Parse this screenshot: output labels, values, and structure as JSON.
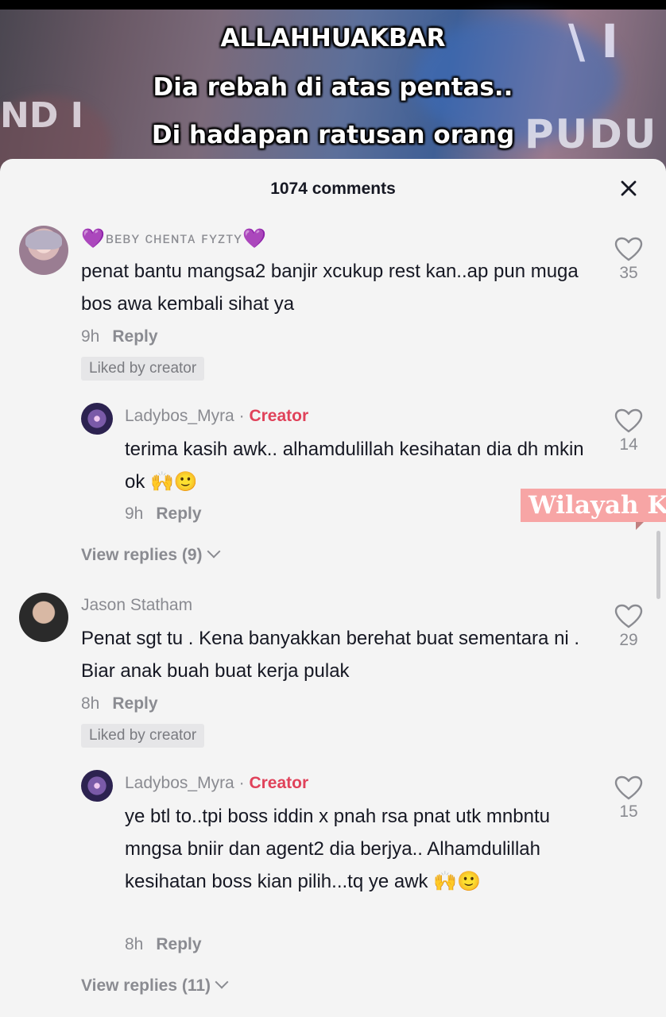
{
  "video": {
    "caption_lines": [
      "ALLAHHUAKBAR",
      "Dia rebah di atas pentas..",
      "Di hadapan ratusan orang"
    ],
    "bg_sign_left": "ND I",
    "bg_sign_right": "PUDU |",
    "bg_sign_top": "\\ I"
  },
  "sheet": {
    "title": "1074 comments"
  },
  "comments": [
    {
      "username": "ʙᴇʙʏ ᴄʜᴇɴᴛᴀ ꜰʏᴢᴛʏ",
      "username_emoji": "💜",
      "text": "penat bantu mangsa2 banjir xcukup rest kan..ap pun muga bos awa kembali sihat ya",
      "time": "9h",
      "reply_label": "Reply",
      "liked_by_creator": "Liked by creator",
      "likes": "35",
      "reply": {
        "username": "Ladybos_Myra",
        "separator": "·",
        "badge": "Creator",
        "text": "terima kasih awk.. alhamdulillah kesihatan dia dh mkin ok",
        "emojis": "🙌🙂",
        "time": "9h",
        "reply_label": "Reply",
        "likes": "14"
      },
      "view_replies": "View replies (9)"
    },
    {
      "username": "Jason Statham",
      "text": "Penat sgt tu . Kena banyakkan berehat buat sementara ni . Biar anak buah buat kerja pulak",
      "time": "8h",
      "reply_label": "Reply",
      "liked_by_creator": "Liked by creator",
      "likes": "29",
      "reply": {
        "username": "Ladybos_Myra",
        "separator": "·",
        "badge": "Creator",
        "text": "ye btl to..tpi boss iddin x pnah rsa pnat utk mnbntu mngsa bniir dan agent2 dia berjya.. Alhamdulillah kesihatan boss kian pilih...tq ye awk",
        "emojis": "🙌🙂",
        "time": "8h",
        "reply_label": "Reply",
        "likes": "15"
      },
      "view_replies": "View replies (11)"
    }
  ],
  "watermark": "Wilayah Ku"
}
